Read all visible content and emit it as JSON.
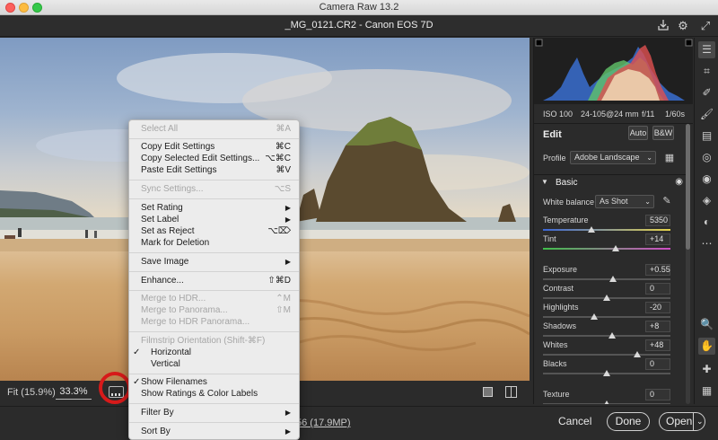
{
  "window": {
    "title": "Camera Raw 13.2"
  },
  "file": {
    "name": "_MG_0121.CR2  -  Canon EOS 7D"
  },
  "exif": {
    "iso": "ISO 100",
    "lens": "24-105@24 mm",
    "aperture": "f/11",
    "shutter": "1/60s"
  },
  "edit": {
    "header": "Edit",
    "auto_label": "Auto",
    "bw_label": "B&W",
    "profile_label": "Profile",
    "profile_value": "Adobe Landscape",
    "section_title": "Basic",
    "wb_label": "White balance",
    "wb_value": "As Shot",
    "sliders": [
      {
        "label": "Temperature",
        "value": "5350",
        "fraction": 0.38
      },
      {
        "label": "Tint",
        "value": "+14",
        "fraction": 0.57
      },
      {
        "label": "Exposure",
        "value": "+0.55",
        "fraction": 0.55
      },
      {
        "label": "Contrast",
        "value": "0",
        "fraction": 0.5
      },
      {
        "label": "Highlights",
        "value": "-20",
        "fraction": 0.4
      },
      {
        "label": "Shadows",
        "value": "+8",
        "fraction": 0.54
      },
      {
        "label": "Whites",
        "value": "+48",
        "fraction": 0.74
      },
      {
        "label": "Blacks",
        "value": "0",
        "fraction": 0.5
      },
      {
        "label": "Texture",
        "value": "0",
        "fraction": 0.5
      }
    ]
  },
  "zoom": {
    "fit": "Fit (15.9%)",
    "level": "33.3%"
  },
  "footer": {
    "info_text": "56 (17.9MP)",
    "cancel": "Cancel",
    "done": "Done",
    "open": "Open"
  },
  "menu": {
    "select_all": "Select All",
    "select_all_sc": "⌘A",
    "copy_edit": "Copy Edit Settings",
    "copy_edit_sc": "⌘C",
    "copy_selected": "Copy Selected Edit Settings...",
    "copy_selected_sc": "⌥⌘C",
    "paste_edit": "Paste Edit Settings",
    "paste_edit_sc": "⌘V",
    "sync": "Sync Settings...",
    "sync_sc": "⌥S",
    "set_rating": "Set Rating",
    "set_label": "Set Label",
    "set_reject": "Set as Reject",
    "set_reject_sc": "⌥⌦",
    "mark_delete": "Mark for Deletion",
    "save_image": "Save Image",
    "enhance": "Enhance...",
    "enhance_sc": "⇧⌘D",
    "merge_hdr": "Merge to HDR...",
    "merge_hdr_sc": "⌃M",
    "merge_pano": "Merge to Panorama...",
    "merge_pano_sc": "⇧M",
    "merge_hdr_pano": "Merge to HDR Panorama...",
    "filmstrip_orientation": "Filmstrip Orientation (Shift-⌘F)",
    "horizontal": "Horizontal",
    "vertical": "Vertical",
    "checkmark": "✓",
    "show_filenames": "Show Filenames",
    "show_ratings": "Show Ratings & Color Labels",
    "filter_by": "Filter By",
    "sort_by": "Sort By"
  }
}
